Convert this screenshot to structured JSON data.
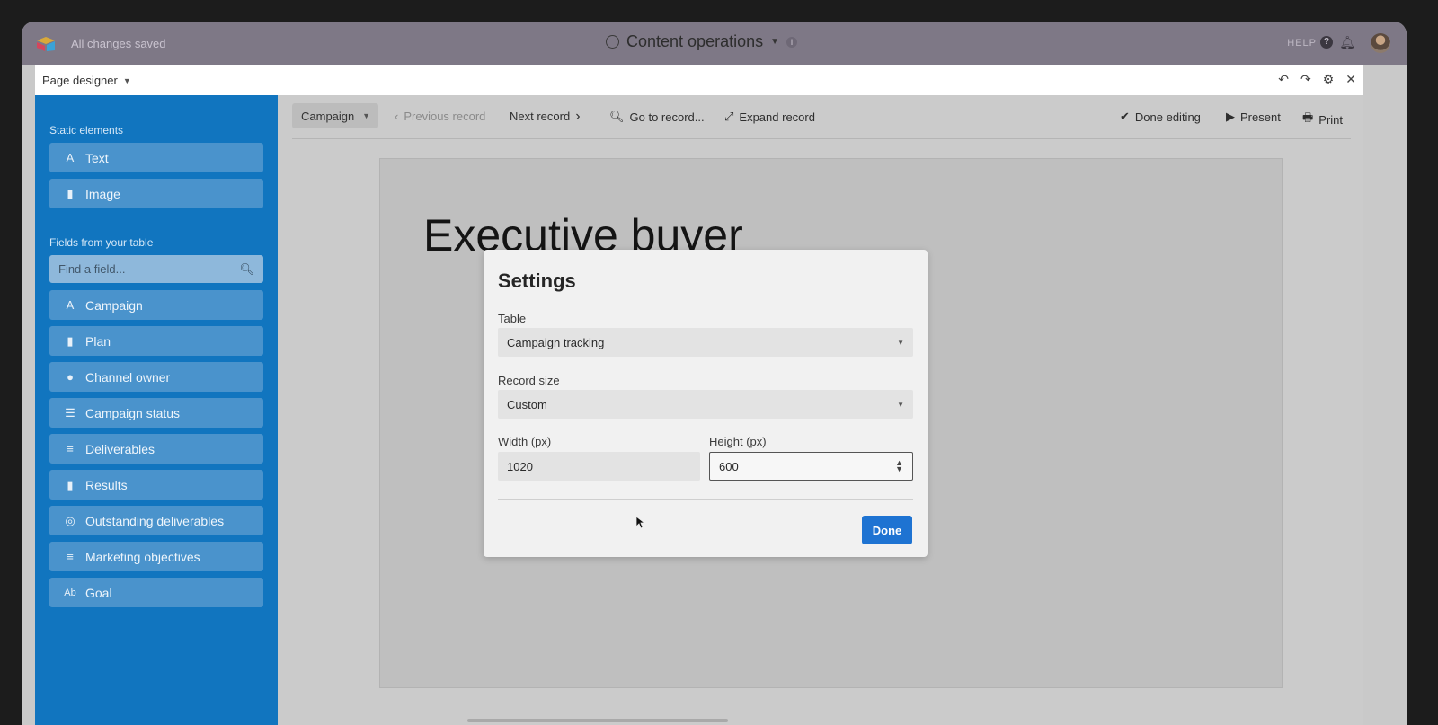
{
  "appbar": {
    "status": "All changes saved",
    "base_name": "Content operations",
    "help_label": "HELP"
  },
  "designer": {
    "title": "Page designer",
    "controls": [
      "↶",
      "↷",
      "⚙",
      "✕"
    ]
  },
  "sidebar": {
    "static_heading": "Static elements",
    "static_items": [
      {
        "label": "Text",
        "icon": "A"
      },
      {
        "label": "Image",
        "icon": "▮"
      }
    ],
    "fields_heading": "Fields from your table",
    "search_placeholder": "Find a field...",
    "field_items": [
      {
        "label": "Campaign",
        "icon": "A"
      },
      {
        "label": "Plan",
        "icon": "▮"
      },
      {
        "label": "Channel owner",
        "icon": "●"
      },
      {
        "label": "Campaign status",
        "icon": "☰"
      },
      {
        "label": "Deliverables",
        "icon": "≡"
      },
      {
        "label": "Results",
        "icon": "▮"
      },
      {
        "label": "Outstanding deliverables",
        "icon": "◎"
      },
      {
        "label": "Marketing objectives",
        "icon": "≡"
      },
      {
        "label": "Goal",
        "icon": "Ab"
      }
    ]
  },
  "toolbar": {
    "table_select": "Campaign",
    "previous": "Previous record",
    "next": "Next record",
    "goto": "Go to record...",
    "expand": "Expand record",
    "done_editing": "Done editing",
    "present": "Present",
    "print": "Print"
  },
  "page": {
    "title": "Executive buyer"
  },
  "settings": {
    "title": "Settings",
    "table_label": "Table",
    "table_value": "Campaign tracking",
    "size_label": "Record size",
    "size_value": "Custom",
    "width_label": "Width (px)",
    "width_value": "1020",
    "height_label": "Height (px)",
    "height_value": "600",
    "done_label": "Done"
  },
  "colors": {
    "sidebar": "#1175bf",
    "primary_button": "#1e73d2"
  }
}
